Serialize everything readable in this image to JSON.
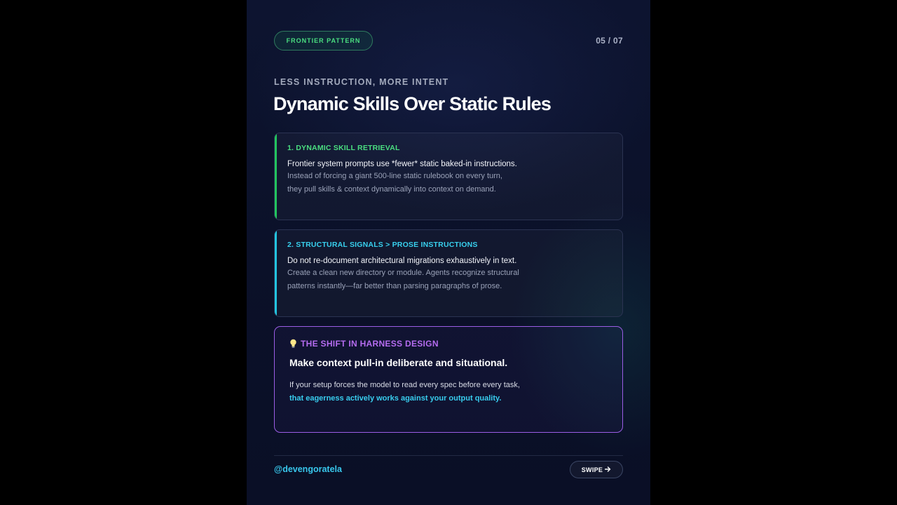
{
  "header": {
    "badge": "FRONTIER PATTERN",
    "page_indicator": "05 / 07"
  },
  "hero": {
    "eyebrow": "LESS INSTRUCTION, MORE INTENT",
    "title": "Dynamic Skills Over Static Rules"
  },
  "cards": [
    {
      "heading": "1. DYNAMIC SKILL RETRIEVAL",
      "lead": "Frontier system prompts use *fewer* static baked-in instructions.",
      "lines": [
        "Instead of forcing a giant 500-line static rulebook on every turn,",
        "they pull skills & context dynamically into context on demand."
      ],
      "accent_color": "#22c55e"
    },
    {
      "heading": "2. STRUCTURAL SIGNALS > PROSE INSTRUCTIONS",
      "lead": "Do not re-document architectural migrations exhaustively in text.",
      "lines": [
        "Create a clean new directory or module. Agents recognize structural",
        "patterns instantly—far better than parsing paragraphs of prose."
      ],
      "accent_color": "#22c5e0"
    }
  ],
  "shift": {
    "icon": "lightbulb-icon",
    "heading": "THE SHIFT IN HARNESS DESIGN",
    "lead": "Make context pull-in deliberate and situational.",
    "body": "If your setup forces the model to read every spec before every task,",
    "highlight": "that eagerness actively works against your output quality.",
    "border_color": "#9b5de5"
  },
  "footer": {
    "handle": "@devengoratela",
    "swipe_label": "SWIPE",
    "swipe_icon": "arrow-right-icon"
  }
}
